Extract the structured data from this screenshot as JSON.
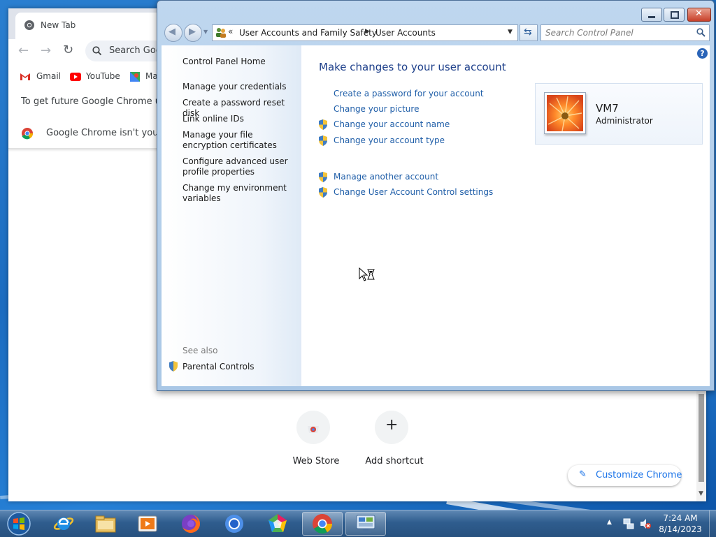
{
  "chrome": {
    "tab_title": "New Tab",
    "search_placeholder": "Search Goo",
    "bookmarks": [
      {
        "label": "Gmail"
      },
      {
        "label": "YouTube"
      },
      {
        "label": "Ma"
      }
    ],
    "update_bar": "To get future Google Chrome upd",
    "default_bar": "Google Chrome isn't your d",
    "shortcuts": [
      {
        "label": "Web Store"
      },
      {
        "label": "Add shortcut"
      }
    ],
    "customize_label": "Customize Chrome"
  },
  "control_panel": {
    "breadcrumb": [
      "User Accounts and Family Safety",
      "User Accounts"
    ],
    "search_placeholder": "Search Control Panel",
    "sidebar": {
      "home": "Control Panel Home",
      "links": [
        "Manage your credentials",
        "Create a password reset disk",
        "Link online IDs",
        "Manage your file encryption certificates",
        "Configure advanced user profile properties",
        "Change my environment variables"
      ],
      "see_also_heading": "See also",
      "see_also_links": [
        "Parental Controls"
      ]
    },
    "heading": "Make changes to your user account",
    "tasks": [
      "Create a password for your account",
      "Change your picture",
      "Change your account name",
      "Change your account type"
    ],
    "other_tasks": [
      "Manage another account",
      "Change User Account Control settings"
    ],
    "user": {
      "name": "VM7",
      "role": "Administrator"
    }
  },
  "taskbar": {
    "apps": [
      "start-orb-icon",
      "internet-explorer-icon",
      "file-explorer-icon",
      "media-player-icon",
      "firefox-icon",
      "chromium-icon",
      "paint-app-icon",
      "chrome-icon",
      "control-panel-icon"
    ],
    "clock_time": "7:24 AM",
    "clock_date": "8/14/2023"
  }
}
